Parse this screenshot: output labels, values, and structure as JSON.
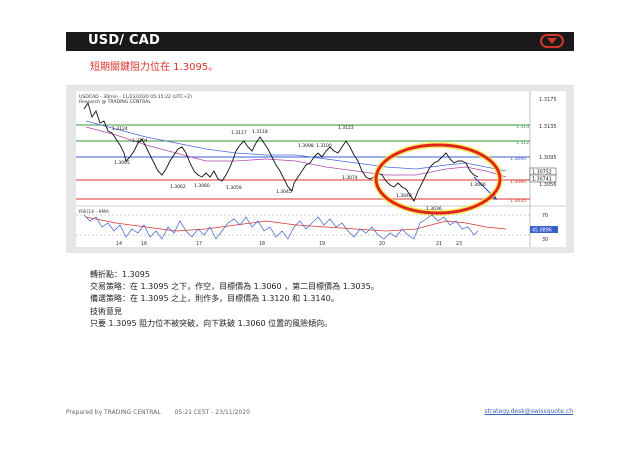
{
  "header": {
    "title": "USD/ CAD",
    "toggle_icon": "chevron-down-icon",
    "accent": "#d9342b"
  },
  "subtitle": "短期關鍵阻力位在 1.3095。",
  "chart": {
    "symbol_line": "USDCAD - 30min - 11/23/2020 05:15:22 (UTC+2)",
    "source_line": "Research @ TRADING CENTRAL",
    "rsi_label": "RSI(14 - 9MA",
    "price_ticks": [
      "1.3175",
      "1.3135",
      "1.3095",
      "1.3056"
    ],
    "hlevels": [
      {
        "label": "1.314",
        "color": "#3a9a3a"
      },
      {
        "label": "1.312",
        "color": "#3a9a3a"
      },
      {
        "label": "1.3095",
        "color": "#3a5fd0"
      },
      {
        "label": "1.3060",
        "color": "#d9342b"
      },
      {
        "label": "1.3035",
        "color": "#d9342b"
      }
    ],
    "last_prices": [
      "1.30752",
      "1.30741"
    ],
    "rsi_ticks": [
      "70",
      "30"
    ],
    "rsi_value": "45.0896",
    "x_labels": [
      "14",
      "16",
      "17",
      "18",
      "19",
      "20",
      "21",
      "23"
    ],
    "swing_labels": [
      "1.3124",
      "1.3104",
      "1.3117",
      "1.3118",
      "1.3098",
      "1.3100",
      "1.3123",
      "1.3095",
      "1.3062",
      "1.3060",
      "1.3059",
      "1.3074",
      "1.3045",
      "1.3048",
      "1.3036",
      "1.3066"
    ]
  },
  "analysis": {
    "pivot": "轉折點：1.3095",
    "strategy": "交易策略：在 1.3095 之下，作空，目標價為 1.3060 ，第二目標價為 1.3035。",
    "alternative": "備選策略：在 1.3095 之上，則作多，目標價為 1.3120 和 1.3140。",
    "comment_title": "技術意見",
    "comment": "只要 1.3095 阻力位不被突破，向下跌破 1.3060 位置的風險傾向。"
  },
  "footer": {
    "prepared": "Prepared by TRADING CENTRAL",
    "timestamp": "05:21 CEST - 23/11/2020",
    "email": "strategy.desk@swissquote.ch"
  }
}
